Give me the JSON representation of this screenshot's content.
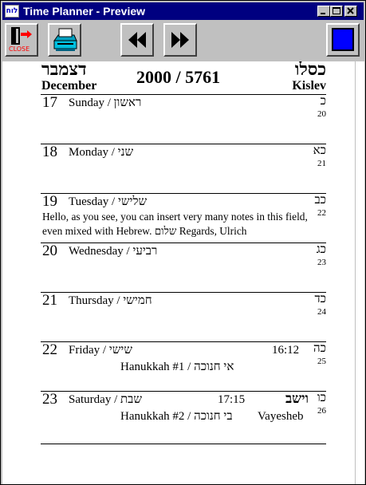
{
  "window": {
    "app_icon_text": "לוח",
    "title": "Time Planner - Preview"
  },
  "toolbar": {
    "close_label": "CLOSE"
  },
  "header": {
    "hebrew_month_left": "דצמבר",
    "gregorian_month": "December",
    "year": "2000 / 5761",
    "hebrew_month_right": "כסלו",
    "hebrew_month_name": "Kislev"
  },
  "days": [
    {
      "num": "17",
      "name": "Sunday / ראשון",
      "hdate": "כ",
      "hnum": "20"
    },
    {
      "num": "18",
      "name": "Monday / שני",
      "hdate": "כא",
      "hnum": "21"
    },
    {
      "num": "19",
      "name": "Tuesday / שלישי",
      "hdate": "כב",
      "hnum": "22",
      "note": "Hello, as you see, you can insert very many notes in this field, even mixed with Hebrew. שלום Regards, Ulrich"
    },
    {
      "num": "20",
      "name": "Wednesday / רביעי",
      "hdate": "כג",
      "hnum": "23"
    },
    {
      "num": "21",
      "name": "Thursday / חמישי",
      "hdate": "כד",
      "hnum": "24"
    },
    {
      "num": "22",
      "name": "Friday / שישי",
      "time": "16:12",
      "hdate": "כה",
      "hnum": "25",
      "holiday": "Hanukkah #1 / אי חנוכה"
    },
    {
      "num": "23",
      "name": "Saturday / שבת",
      "time": "17:15",
      "parasha_he": "וישב",
      "hdate": "כו",
      "hnum": "26",
      "holiday": "Hanukkah #2 / בי חנוכה",
      "parasha_en": "Vayesheb"
    }
  ],
  "colors": {
    "titlebar": "#000080",
    "face": "#c0c0c0",
    "page": "#ffffff",
    "stop_square": "#0000ff",
    "door_arrow": "#ff0000"
  }
}
